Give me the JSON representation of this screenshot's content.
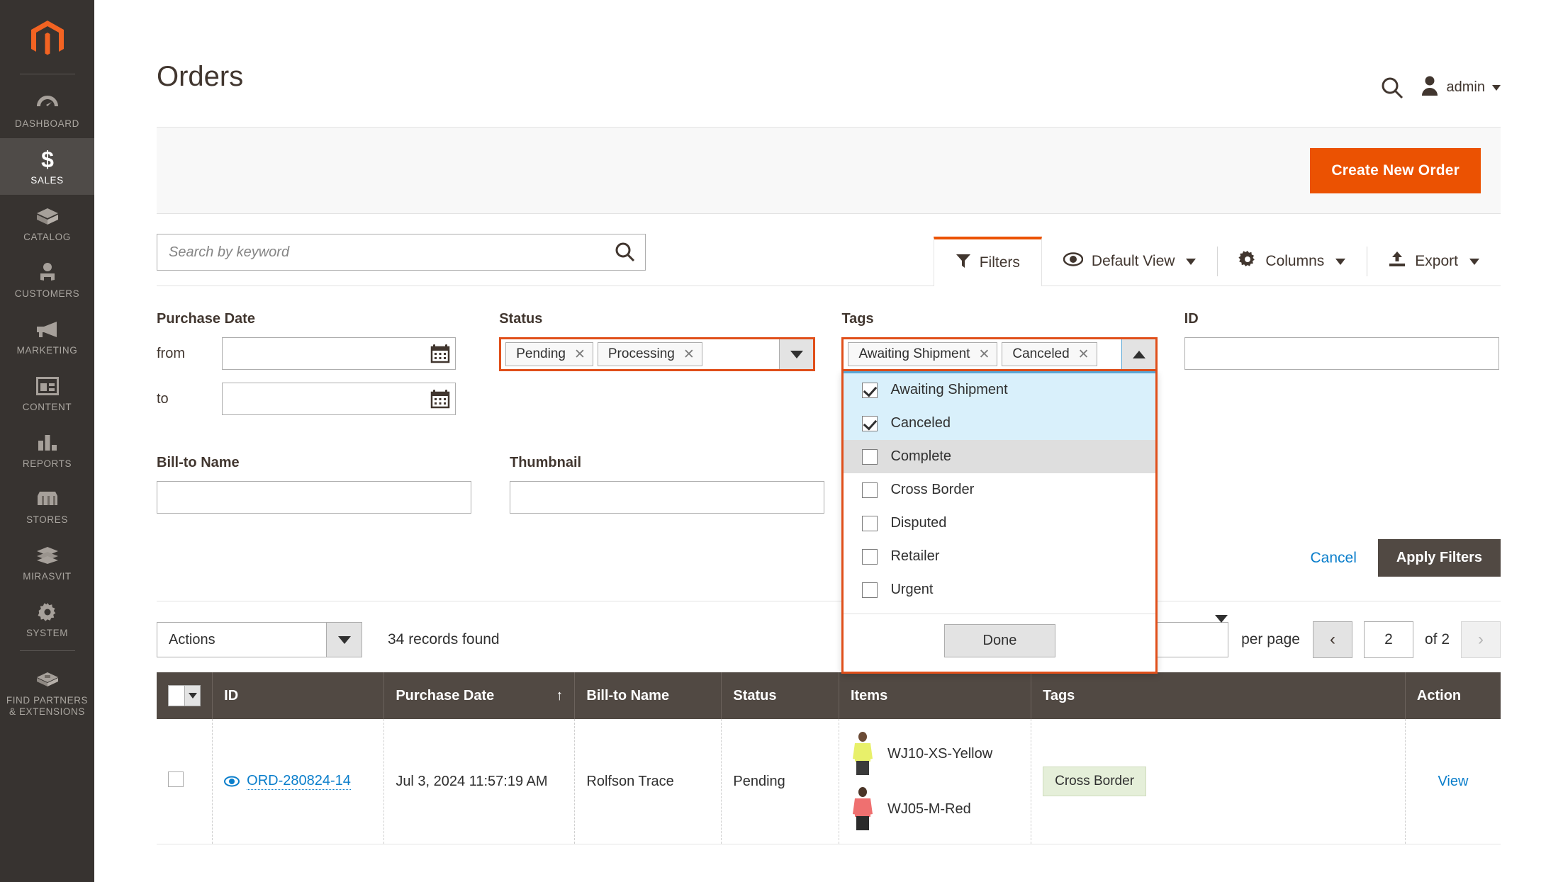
{
  "sidebar": {
    "logo": "magento-logo",
    "items": [
      {
        "label": "DASHBOARD",
        "icon": "dashboard-icon",
        "active": false
      },
      {
        "label": "SALES",
        "icon": "dollar-icon",
        "active": true
      },
      {
        "label": "CATALOG",
        "icon": "box-icon",
        "active": false
      },
      {
        "label": "CUSTOMERS",
        "icon": "person-icon",
        "active": false
      },
      {
        "label": "MARKETING",
        "icon": "megaphone-icon",
        "active": false
      },
      {
        "label": "CONTENT",
        "icon": "layout-icon",
        "active": false
      },
      {
        "label": "REPORTS",
        "icon": "bar-chart-icon",
        "active": false
      },
      {
        "label": "STORES",
        "icon": "storefront-icon",
        "active": false
      },
      {
        "label": "MIRASVIT",
        "icon": "stack-icon",
        "active": false
      },
      {
        "label": "SYSTEM",
        "icon": "gear-icon",
        "active": false
      },
      {
        "label": "FIND PARTNERS\n& EXTENSIONS",
        "icon": "crate-icon",
        "active": false
      }
    ],
    "find_partners_line1": "FIND PARTNERS",
    "find_partners_line2": "& EXTENSIONS"
  },
  "header": {
    "title": "Orders",
    "search_icon": "search-icon",
    "user_icon": "user-avatar-icon",
    "user_name": "admin"
  },
  "page_actions": {
    "create_new_order": "Create New Order"
  },
  "toolbar": {
    "search_placeholder": "Search by keyword",
    "search_value": "",
    "tabs": [
      {
        "label": "Filters",
        "icon": "funnel-icon",
        "active": true,
        "has_arrow": false
      },
      {
        "label": "Default View",
        "icon": "eye-icon",
        "active": false,
        "has_arrow": true
      },
      {
        "label": "Columns",
        "icon": "gear-icon",
        "active": false,
        "has_arrow": true
      },
      {
        "label": "Export",
        "icon": "export-icon",
        "active": false,
        "has_arrow": true
      }
    ]
  },
  "filters": {
    "purchase_date": {
      "label": "Purchase Date",
      "from_label": "from",
      "from_value": "",
      "to_label": "to",
      "to_value": "",
      "calendar_icon": "calendar-icon"
    },
    "status": {
      "label": "Status",
      "chips": [
        "Pending",
        "Processing"
      ],
      "toggle_icon": "chevron-down-icon",
      "highlighted": true
    },
    "tags": {
      "label": "Tags",
      "chips": [
        "Awaiting Shipment",
        "Canceled"
      ],
      "toggle_icon": "chevron-up-icon",
      "highlighted": true,
      "open": true,
      "options": [
        {
          "label": "Awaiting Shipment",
          "checked": true,
          "state": "selected"
        },
        {
          "label": "Canceled",
          "checked": true,
          "state": "selected"
        },
        {
          "label": "Complete",
          "checked": false,
          "state": "hover"
        },
        {
          "label": "Cross Border",
          "checked": false,
          "state": "normal"
        },
        {
          "label": "Disputed",
          "checked": false,
          "state": "normal"
        },
        {
          "label": "Retailer",
          "checked": false,
          "state": "normal"
        },
        {
          "label": "Urgent",
          "checked": false,
          "state": "normal"
        }
      ],
      "done_label": "Done"
    },
    "id": {
      "label": "ID",
      "value": ""
    },
    "bill_to_name": {
      "label": "Bill-to Name",
      "value": ""
    },
    "thumbnail": {
      "label": "Thumbnail",
      "value": ""
    },
    "cancel_label": "Cancel",
    "apply_label": "Apply Filters"
  },
  "grid_toolbar": {
    "actions_label": "Actions",
    "records_found": "34 records found",
    "per_page_value": "",
    "per_page_label": "per page",
    "prev_icon": "chevron-left-icon",
    "next_icon": "chevron-right-icon",
    "page_value": "2",
    "page_of": "of 2"
  },
  "table": {
    "columns": [
      {
        "key": "mass",
        "label": ""
      },
      {
        "key": "id",
        "label": "ID"
      },
      {
        "key": "purchase_date",
        "label": "Purchase Date",
        "sorted": "asc",
        "sort_glyph": "↑"
      },
      {
        "key": "bill_to_name",
        "label": "Bill-to Name"
      },
      {
        "key": "status",
        "label": "Status"
      },
      {
        "key": "items",
        "label": "Items"
      },
      {
        "key": "tags",
        "label": "Tags"
      },
      {
        "key": "action",
        "label": "Action"
      }
    ],
    "rows": [
      {
        "selected": false,
        "id": "ORD-280824-14",
        "id_icon": "eye-view-icon",
        "purchase_date": "Jul 3, 2024 11:57:19 AM",
        "bill_to_name": "Rolfson Trace",
        "status": "Pending",
        "items": [
          {
            "sku": "WJ10-XS-Yellow",
            "thumb_color": "#e8f06a"
          },
          {
            "sku": "WJ05-M-Red",
            "thumb_color": "#ef7070"
          }
        ],
        "tags": [
          "Cross Border"
        ],
        "action": "View"
      }
    ]
  },
  "colors": {
    "accent_orange": "#eb5202",
    "highlight_red": "#e04f1a",
    "link_blue": "#0a7ecb",
    "sidebar_bg": "#373330",
    "table_header": "#514943",
    "selected_row_bg": "#d9f0fb",
    "tag_badge_bg": "#e5efd9"
  }
}
